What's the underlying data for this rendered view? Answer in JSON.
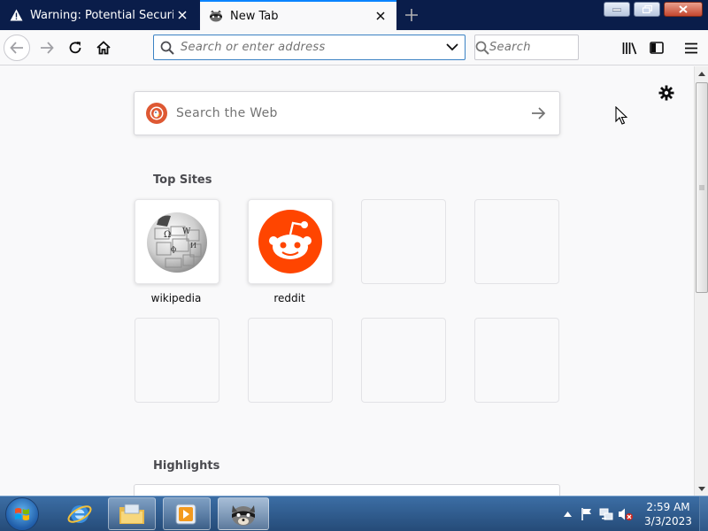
{
  "tabs": [
    {
      "title": "Warning: Potential Security Risk Ahead",
      "icon": "warning-icon",
      "active": false
    },
    {
      "title": "New Tab",
      "icon": "raccoon-favicon-icon",
      "active": true
    }
  ],
  "navbar": {
    "url_placeholder": "Search or enter address",
    "search_placeholder": "Search"
  },
  "newtab": {
    "web_search_placeholder": "Search the Web",
    "top_sites_title": "Top Sites",
    "highlights_title": "Highlights",
    "top_sites": [
      {
        "label": "wikipedia",
        "icon": "wikipedia-globe-icon"
      },
      {
        "label": "reddit",
        "icon": "reddit-alien-icon"
      }
    ]
  },
  "taskbar": {
    "time": "2:59 AM",
    "date": "3/3/2023"
  },
  "colors": {
    "tabbar_bg": "#0a1d4a",
    "accent": "#0a84ff",
    "reddit": "#ff4500",
    "duckduckgo": "#de5833"
  }
}
